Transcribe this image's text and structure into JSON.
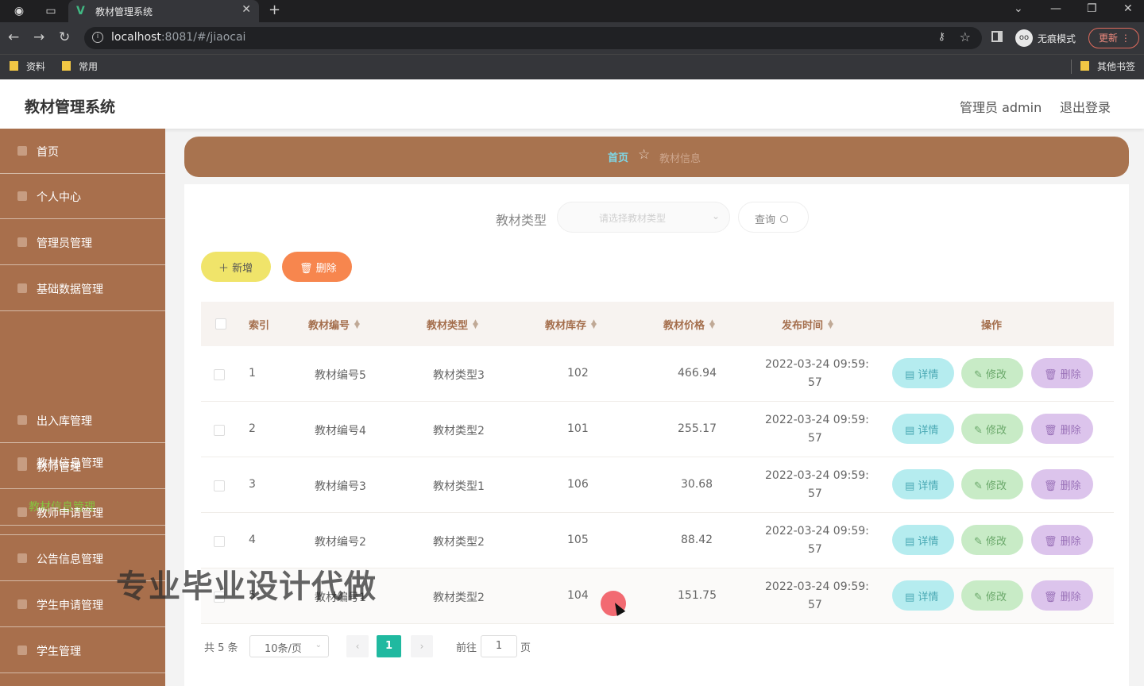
{
  "browser": {
    "tab_title": "教材管理系统",
    "url_host": "localhost",
    "url_path": ":8081/#/jiaocai",
    "incognito_label": "无痕模式",
    "update_label": "更新",
    "bookmarks": [
      "资料",
      "常用"
    ],
    "other_bookmarks": "其他书签"
  },
  "header": {
    "title": "教材管理系统",
    "admin": "管理员 admin",
    "logout": "退出登录"
  },
  "sidebar": {
    "items": [
      "首页",
      "个人中心",
      "管理员管理",
      "基础数据管理",
      "教材信息管理",
      "出入库管理",
      "教师管理",
      "教师申请管理",
      "公告信息管理",
      "学生申请管理",
      "学生管理"
    ],
    "active_sub": "教材信息管理"
  },
  "breadcrumb": {
    "home": "首页",
    "current": "教材信息"
  },
  "filter": {
    "label": "教材类型",
    "placeholder": "请选择教材类型",
    "query_label": "查询"
  },
  "toolbar": {
    "add_label": "新增",
    "delete_label": "删除"
  },
  "table": {
    "headers": [
      "索引",
      "教材编号",
      "教材类型",
      "教材库存",
      "教材价格",
      "发布时间",
      "操作"
    ],
    "rows": [
      {
        "index": "1",
        "code": "教材编号5",
        "type": "教材类型3",
        "stock": "102",
        "price": "466.94",
        "time1": "2022-03-24 09:59:",
        "time2": "57"
      },
      {
        "index": "2",
        "code": "教材编号4",
        "type": "教材类型2",
        "stock": "101",
        "price": "255.17",
        "time1": "2022-03-24 09:59:",
        "time2": "57"
      },
      {
        "index": "3",
        "code": "教材编号3",
        "type": "教材类型1",
        "stock": "106",
        "price": "30.68",
        "time1": "2022-03-24 09:59:",
        "time2": "57"
      },
      {
        "index": "4",
        "code": "教材编号2",
        "type": "教材类型2",
        "stock": "105",
        "price": "88.42",
        "time1": "2022-03-24 09:59:",
        "time2": "57"
      },
      {
        "index": "5",
        "code": "教材编号1",
        "type": "教材类型2",
        "stock": "104",
        "price": "151.75",
        "time1": "2022-03-24 09:59:",
        "time2": "57"
      }
    ],
    "actions": {
      "detail": "详情",
      "edit": "修改",
      "remove": "删除"
    }
  },
  "pagination": {
    "total": "共 5 条",
    "page_size": "10条/页",
    "current": "1",
    "goto_label": "前往",
    "goto_value": "1",
    "unit": "页"
  },
  "overlay": {
    "watermark": "专业毕业设计代做"
  },
  "colors": {
    "sidebar": "#a86f4c",
    "accent_green": "#20b9a0",
    "add_button": "#f0e46a",
    "delete_button": "#f7864e"
  }
}
